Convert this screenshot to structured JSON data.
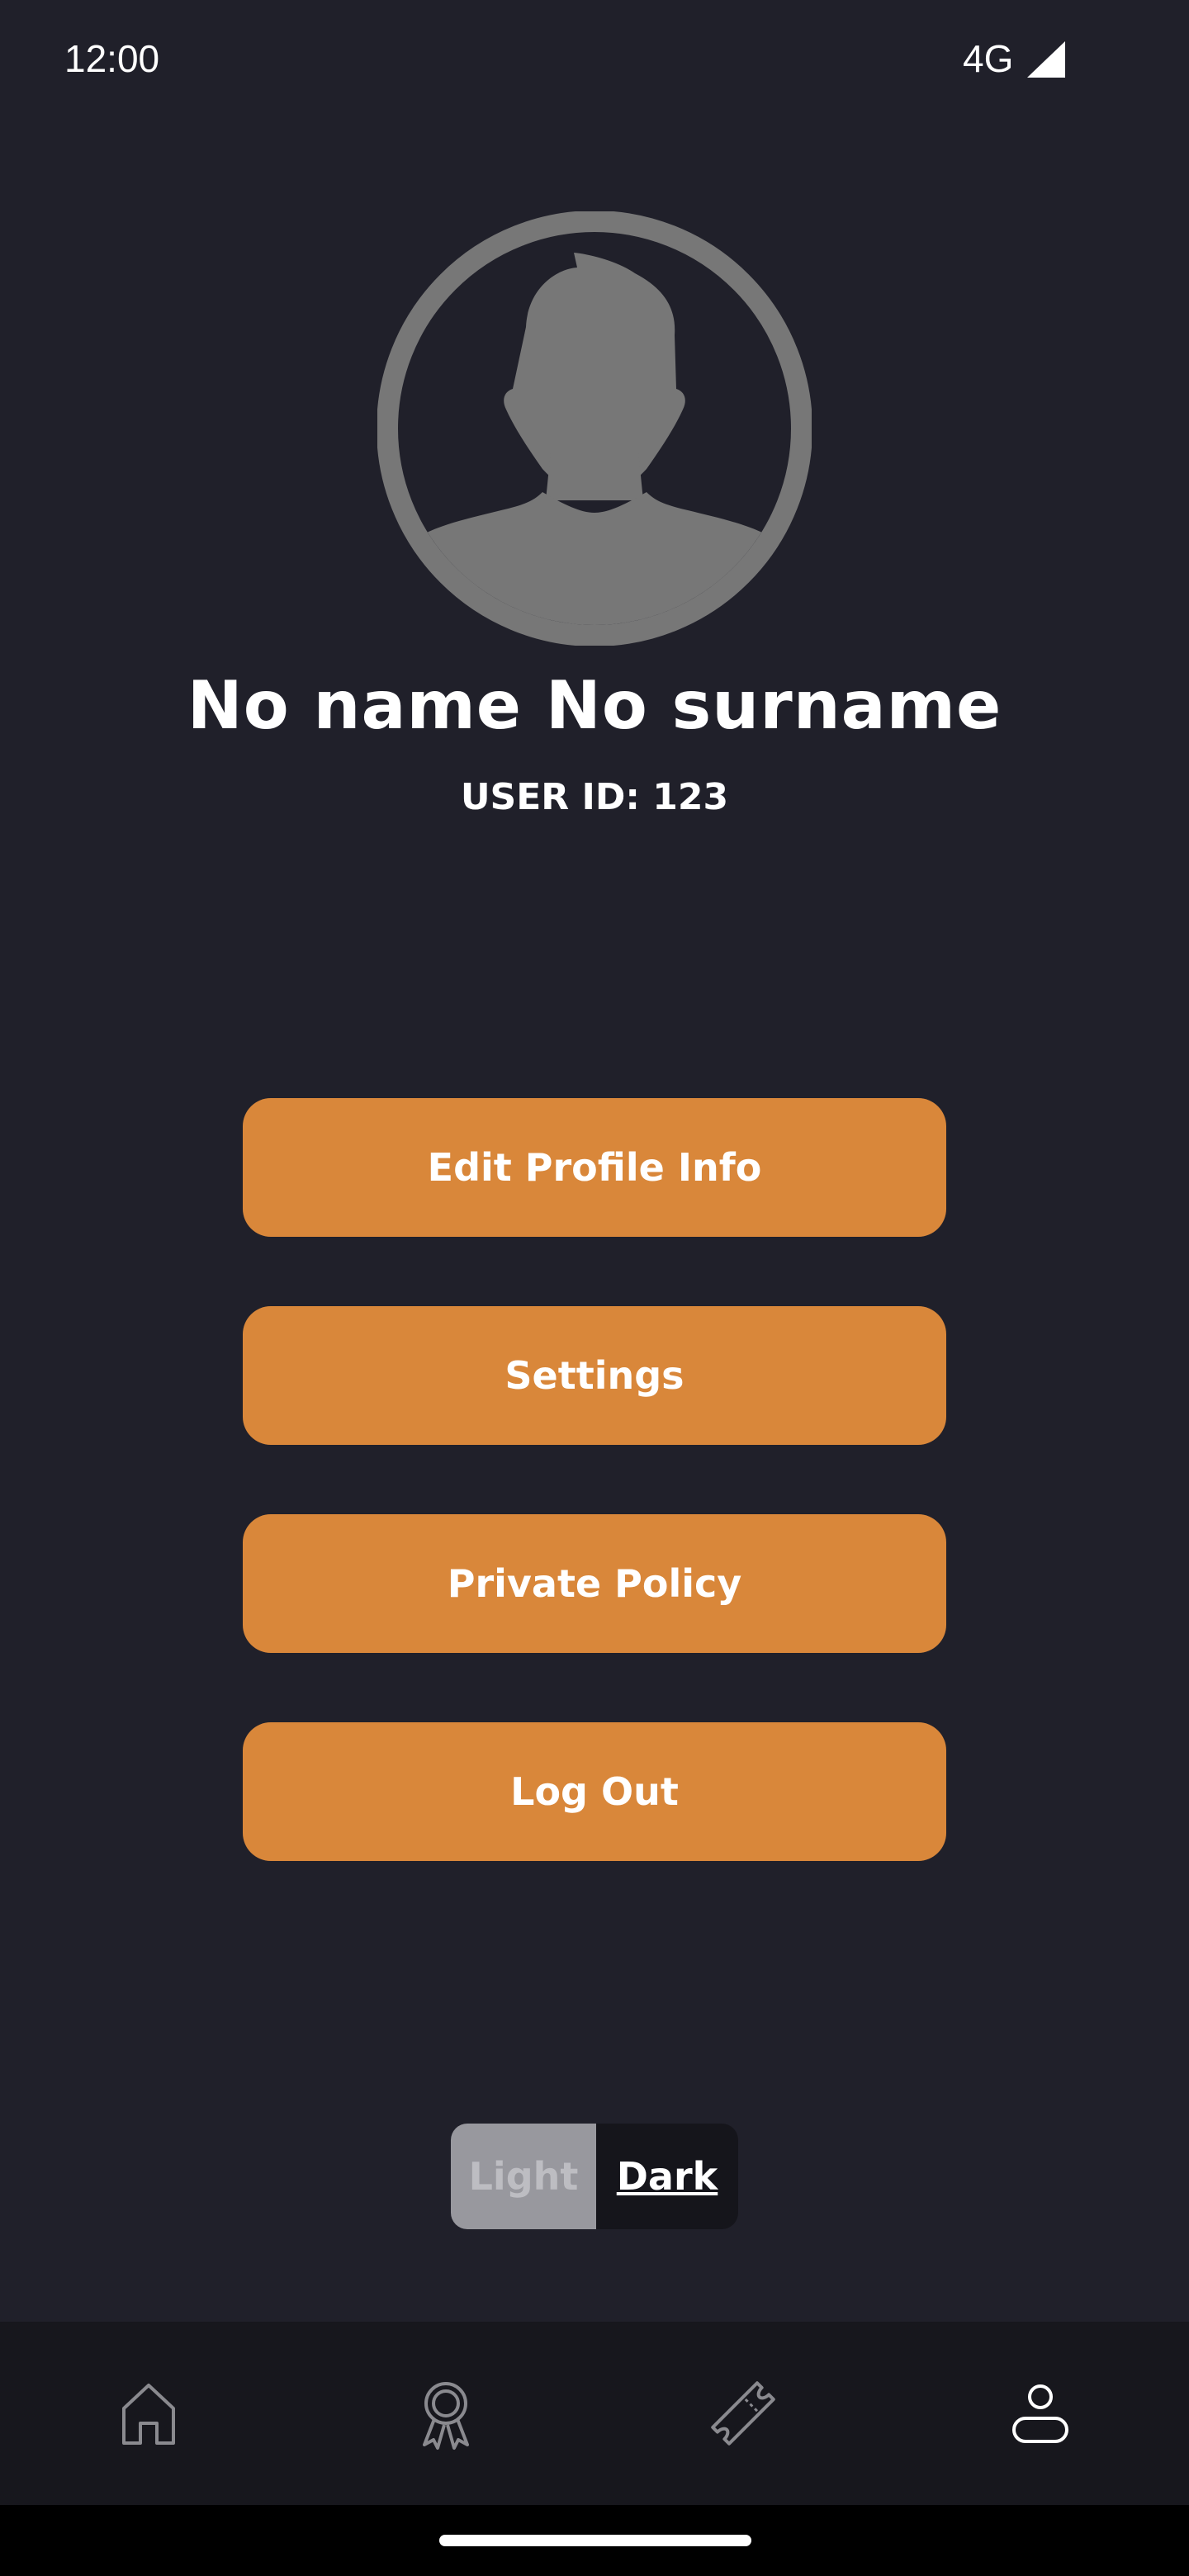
{
  "status_bar": {
    "time": "12:00",
    "network": "4G"
  },
  "profile": {
    "name": "No name No surname",
    "user_id": "USER ID: 123"
  },
  "menu": {
    "edit_profile": "Edit Profile Info",
    "settings": "Settings",
    "privacy_policy": "Private Policy",
    "log_out": "Log Out"
  },
  "theme_toggle": {
    "light_label": "Light",
    "dark_label": "Dark",
    "selected": "Dark"
  },
  "bottom_nav": {
    "items": [
      {
        "icon": "home-icon",
        "active": false
      },
      {
        "icon": "award-icon",
        "active": false
      },
      {
        "icon": "ticket-icon",
        "active": false
      },
      {
        "icon": "profile-icon",
        "active": true
      }
    ]
  },
  "colors": {
    "background": "#20202a",
    "accent": "#d9873a",
    "nav_background": "#17171d",
    "avatar_gray": "#777777"
  }
}
